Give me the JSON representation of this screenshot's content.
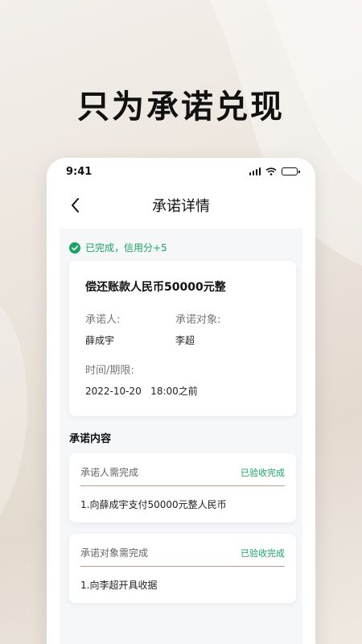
{
  "promo": {
    "title": "只为承诺兑现"
  },
  "status_bar": {
    "time": "9:41"
  },
  "nav": {
    "title": "承诺详情"
  },
  "completion": {
    "text": "已完成，信用分+5"
  },
  "promise": {
    "headline": "偿还账款人民币50000元整",
    "promisor_label": "承诺人:",
    "promisor_value": "薛成宇",
    "target_label": "承诺对象:",
    "target_value": "李超",
    "deadline_label": "时间/期限:",
    "deadline_value": "2022-10-20   18:00之前"
  },
  "content_section": {
    "title": "承诺内容",
    "items": [
      {
        "label": "承诺人需完成",
        "status": "已验收完成",
        "detail": "1.向薛成宇支付50000元整人民币"
      },
      {
        "label": "承诺对象需完成",
        "status": "已验收完成",
        "detail": "1.向李超开具收据"
      }
    ]
  },
  "colors": {
    "accent_green": "#19a463",
    "divider_brown": "#b99a86"
  }
}
